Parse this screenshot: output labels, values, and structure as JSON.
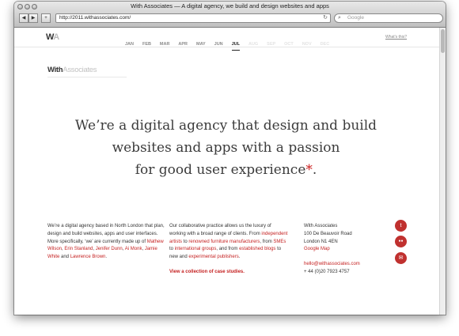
{
  "browser": {
    "title": "With Associates — A digital agency, we build and design websites and apps",
    "url": "http://2011.withassociates.com/",
    "search_placeholder": "Google",
    "back_glyph": "◀",
    "forward_glyph": "▶",
    "add_glyph": "+",
    "reload_glyph": "↻",
    "search_glyph": "⌕"
  },
  "nav": {
    "logo_w": "W",
    "logo_a": "A",
    "months": [
      "JAN",
      "FEB",
      "MAR",
      "APR",
      "MAY",
      "JUN",
      "JUL",
      "AUG",
      "SEP",
      "OCT",
      "NOV",
      "DEC"
    ],
    "active_month": "JUL",
    "whats_this": "What's this?"
  },
  "brand": {
    "with": "With",
    "associates": "Associates"
  },
  "headline": {
    "line1": "We’re a digital agency that design and build",
    "line2": "websites and apps with a passion",
    "line3": "for good user experience",
    "asterisk": "*",
    "period": "."
  },
  "about": {
    "t1": "We’re a digital agency based in North London that plan, design and build websites, apps and user interfaces. More specifically, ‘we’ are currently made up of ",
    "p1": "Mathew Wilson",
    "s1": ", ",
    "p2": "Erin Stanland",
    "s2": ", ",
    "p3": "Jenifer Dunn",
    "s3": ", ",
    "p4": "Ai Monk",
    "s4": ", ",
    "p5": "Jamie White",
    "s5": " and ",
    "p6": "Lawrence Brown",
    "t_end": "."
  },
  "practice": {
    "t1": "Our collaborative practice allows us the luxury of working with a broad range of clients. From ",
    "l1": "independent artists",
    "t2": " to ",
    "l2": "renowned furniture manufacturers",
    "t3": ", from ",
    "l3": "SMEs",
    "t4": " to ",
    "l4": "international groups",
    "t5": ", and from ",
    "l5": "established blogs",
    "t6": " to new and ",
    "l6": "experimental publishers",
    "t7": ".",
    "cta": "View a collection of case studies."
  },
  "contact": {
    "name": "With Associates",
    "street": "100 De Beauvoir Road",
    "city": "London N1 4EN",
    "map_link": "Google Map",
    "email": "hello@withassociates.com",
    "phone": "+ 44 (0)20 7923 4757"
  },
  "social": {
    "twitter_glyph": "t",
    "flickr_glyph": "●●",
    "email_glyph": "✉"
  },
  "colors": {
    "accent": "#c41f1f",
    "social_bg": "#c0312f"
  }
}
